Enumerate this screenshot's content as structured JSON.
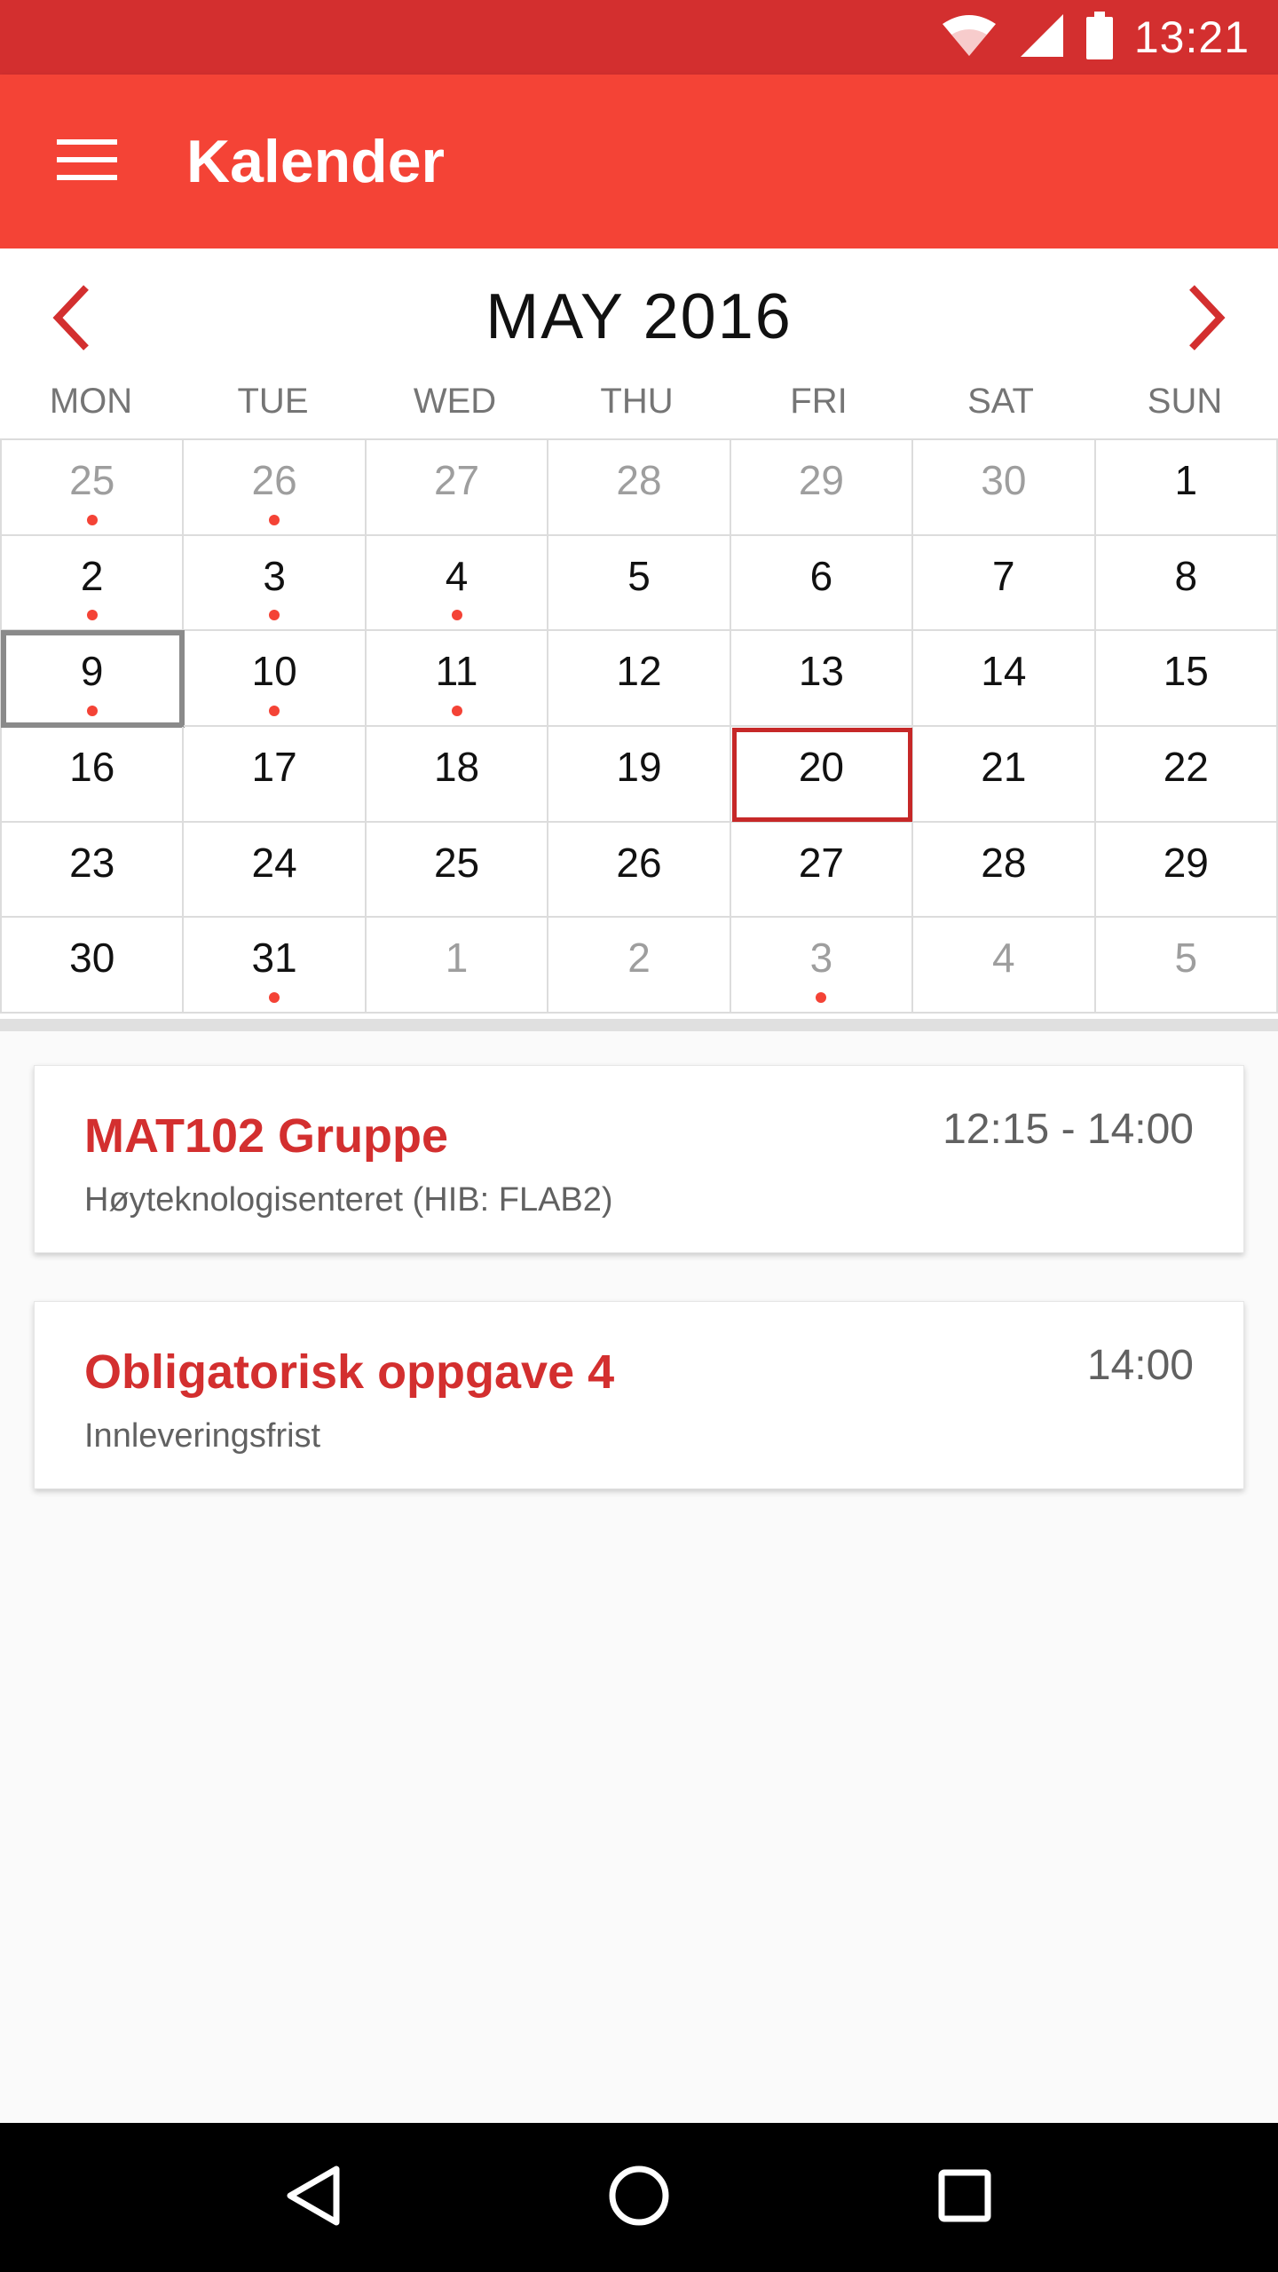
{
  "status_bar": {
    "time": "13:21",
    "wifi_icon": "wifi-icon",
    "signal_icon": "signal-icon",
    "battery_icon": "battery-icon"
  },
  "app_bar": {
    "title": "Kalender",
    "menu_icon": "hamburger-menu-icon"
  },
  "calendar": {
    "month_label": "MAY 2016",
    "weekdays": [
      "MON",
      "TUE",
      "WED",
      "THU",
      "FRI",
      "SAT",
      "SUN"
    ],
    "weeks": [
      [
        {
          "d": "25",
          "o": true,
          "e": true
        },
        {
          "d": "26",
          "o": true,
          "e": true
        },
        {
          "d": "27",
          "o": true
        },
        {
          "d": "28",
          "o": true
        },
        {
          "d": "29",
          "o": true
        },
        {
          "d": "30",
          "o": true
        },
        {
          "d": "1"
        }
      ],
      [
        {
          "d": "2",
          "e": true
        },
        {
          "d": "3",
          "e": true
        },
        {
          "d": "4",
          "e": true
        },
        {
          "d": "5"
        },
        {
          "d": "6"
        },
        {
          "d": "7"
        },
        {
          "d": "8"
        }
      ],
      [
        {
          "d": "9",
          "e": true,
          "sel": true
        },
        {
          "d": "10",
          "e": true
        },
        {
          "d": "11",
          "e": true
        },
        {
          "d": "12"
        },
        {
          "d": "13"
        },
        {
          "d": "14"
        },
        {
          "d": "15"
        }
      ],
      [
        {
          "d": "16"
        },
        {
          "d": "17"
        },
        {
          "d": "18"
        },
        {
          "d": "19"
        },
        {
          "d": "20",
          "today": true
        },
        {
          "d": "21"
        },
        {
          "d": "22"
        }
      ],
      [
        {
          "d": "23"
        },
        {
          "d": "24"
        },
        {
          "d": "25"
        },
        {
          "d": "26"
        },
        {
          "d": "27"
        },
        {
          "d": "28"
        },
        {
          "d": "29"
        }
      ],
      [
        {
          "d": "30"
        },
        {
          "d": "31",
          "e": true
        },
        {
          "d": "1",
          "o": true
        },
        {
          "d": "2",
          "o": true
        },
        {
          "d": "3",
          "o": true,
          "e": true
        },
        {
          "d": "4",
          "o": true
        },
        {
          "d": "5",
          "o": true
        }
      ]
    ]
  },
  "events": [
    {
      "title": "MAT102 Gruppe",
      "time": "12:15 - 14:00",
      "subtitle": "Høyteknologisenteret (HIB: FLAB2)"
    },
    {
      "title": "Obligatorisk oppgave 4",
      "time": "14:00",
      "subtitle": "Innleveringsfrist"
    }
  ],
  "colors": {
    "status_bar": "#d32f2f",
    "app_bar": "#f44336",
    "accent": "#d32f2f",
    "event_dot": "#f44336"
  }
}
